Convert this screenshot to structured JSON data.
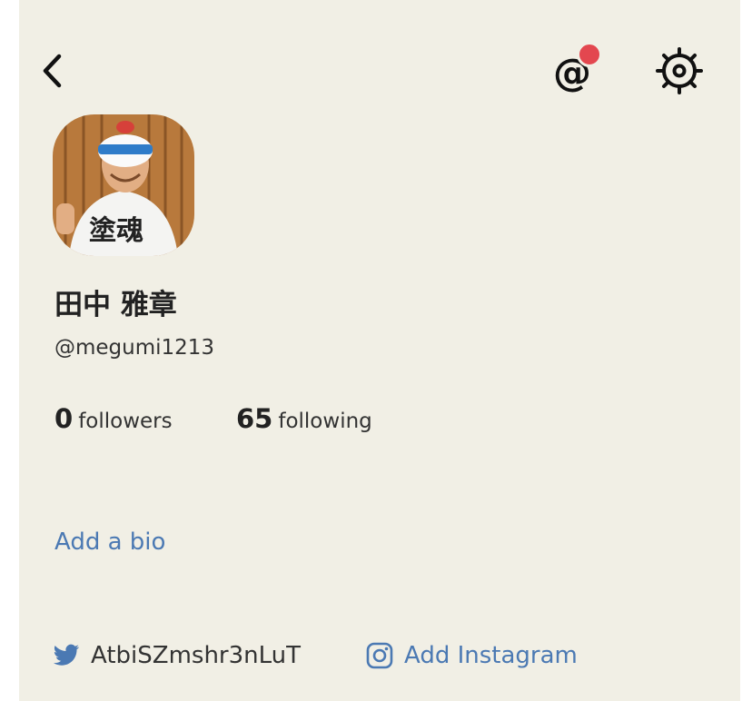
{
  "header": {
    "back_icon": "chevron-left-icon",
    "mention_icon": "at-sign-icon",
    "mention_glyph": "@",
    "has_notification": true,
    "settings_icon": "gear-icon",
    "colors": {
      "background": "#f1efe5",
      "notification_dot": "#e3474f"
    }
  },
  "profile": {
    "avatar_icon": "user-avatar-photo",
    "name": "田中 雅章",
    "handle": "@megumi1213",
    "followers": {
      "count": "0",
      "label": "followers"
    },
    "following": {
      "count": "65",
      "label": "following"
    },
    "bio_prompt": "Add a bio",
    "link_color": "#4b79b3"
  },
  "social": {
    "twitter": {
      "icon": "twitter-bird-icon",
      "handle": "AtbiSZmshr3nLuT",
      "color": "#4b79b3"
    },
    "instagram": {
      "icon": "instagram-icon",
      "label": "Add Instagram"
    }
  }
}
